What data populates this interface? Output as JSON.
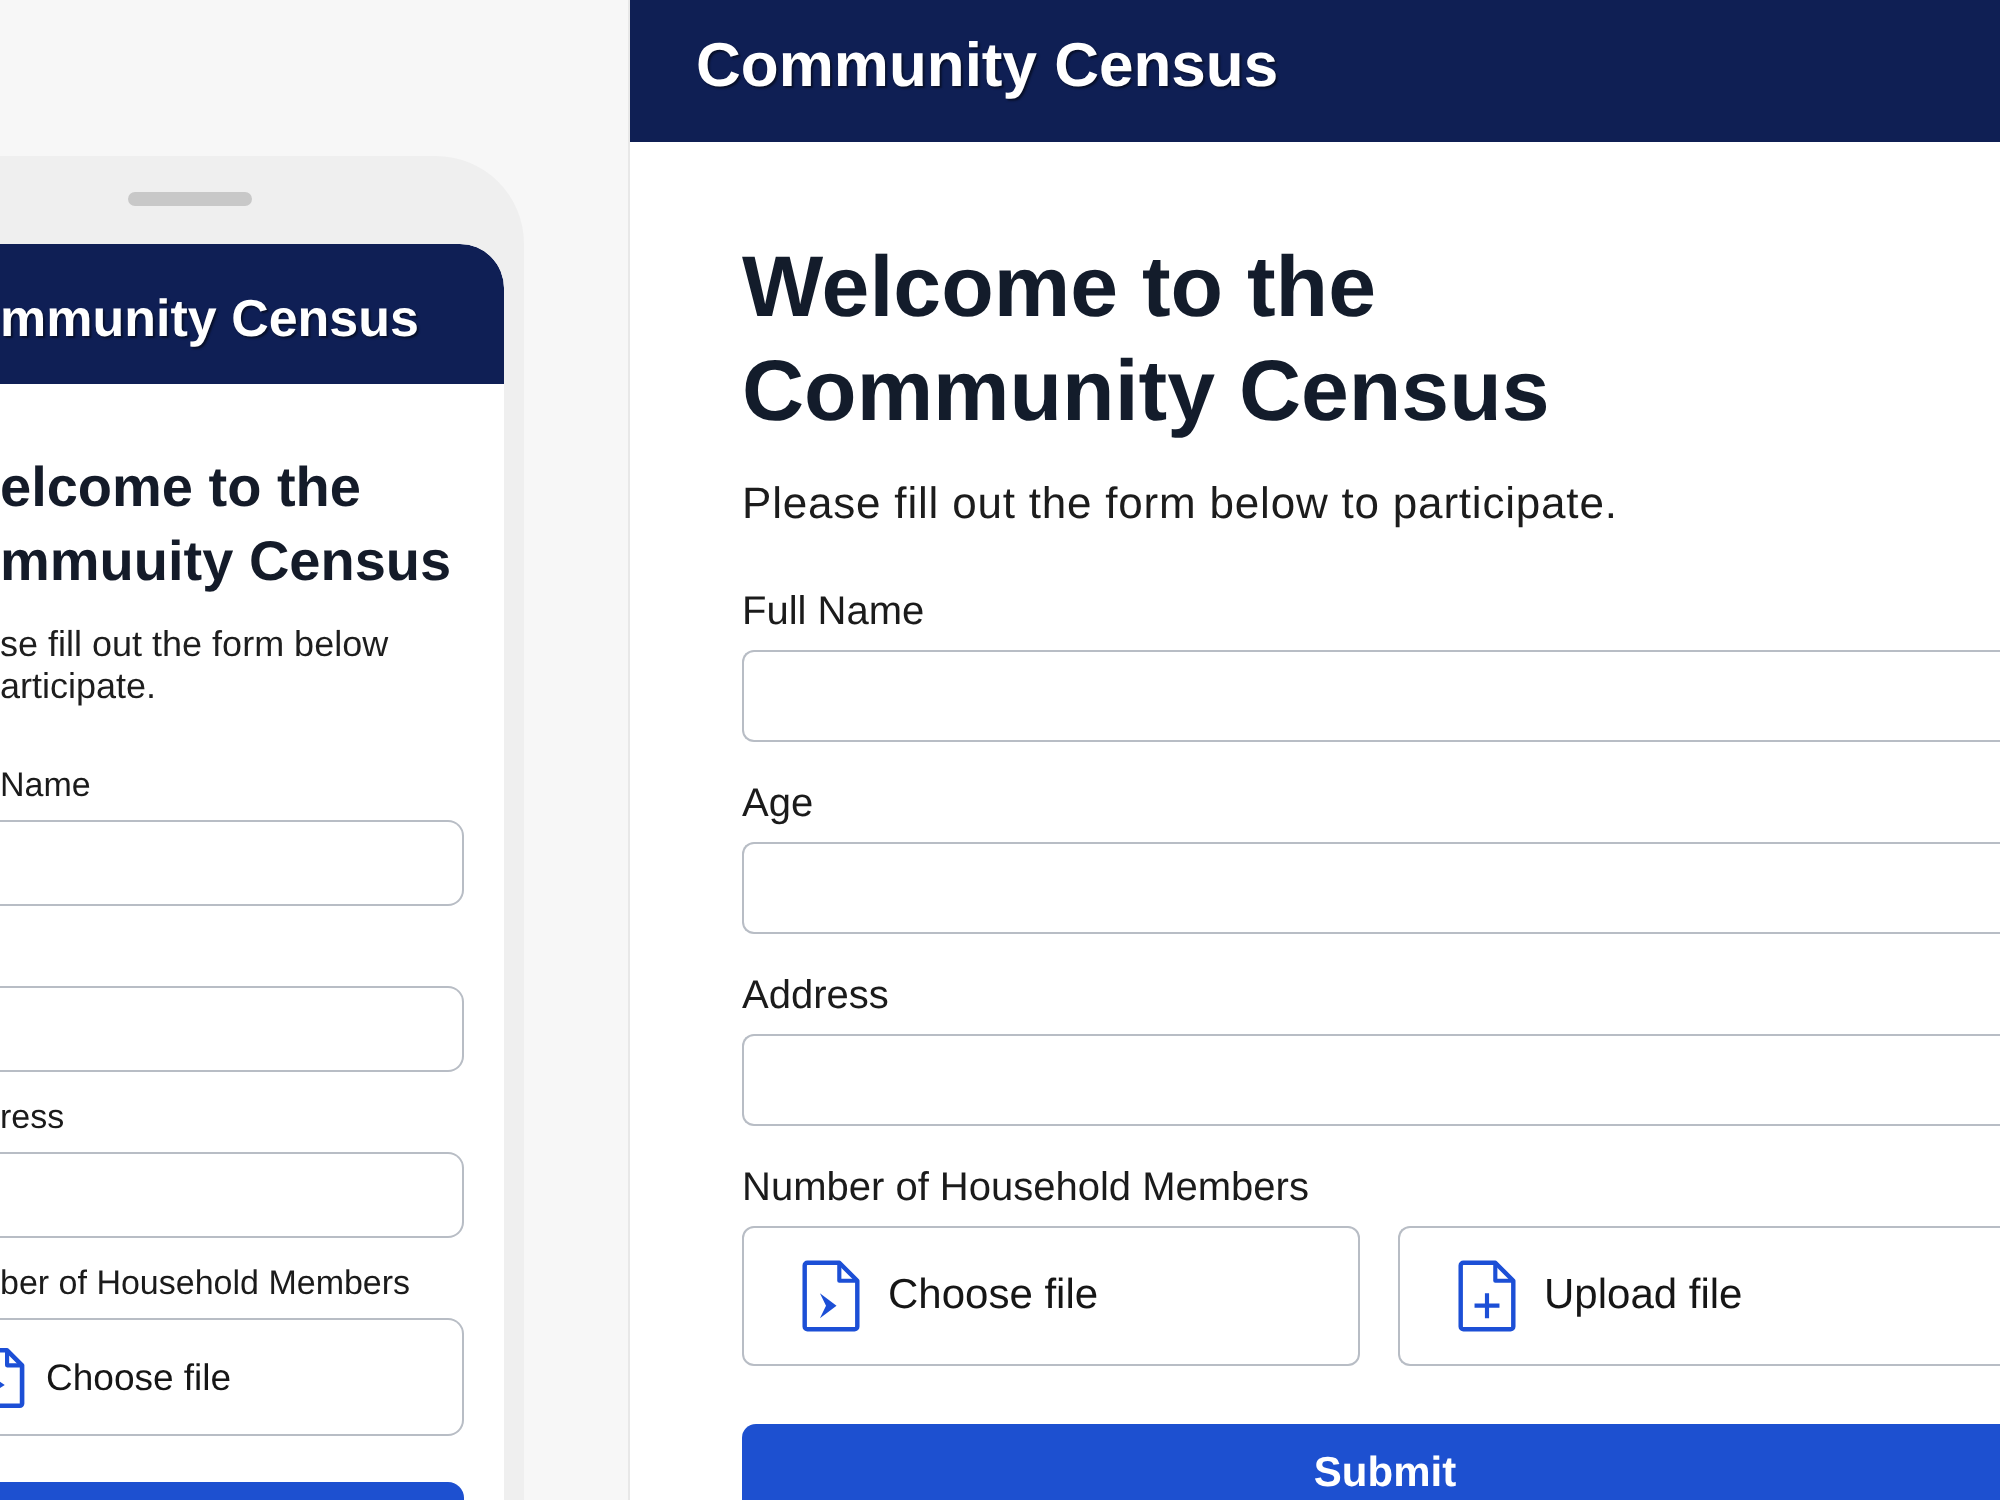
{
  "phone": {
    "header_title": "mmunity Census",
    "heading_lines": [
      "elcome to the",
      "mmuuity Census"
    ],
    "intro_lines": [
      "se fill out the form below",
      "articipate."
    ],
    "fields": [
      {
        "kind": "text",
        "label": "Name"
      },
      {
        "kind": "text"
      },
      {
        "kind": "text",
        "label": "ress"
      },
      {
        "kind": "file",
        "label": "ber of Household Members",
        "buttons": [
          {
            "kind": "choose",
            "label": "Choose file"
          }
        ]
      }
    ]
  },
  "header": {
    "title": "Community Census"
  },
  "form": {
    "heading": "Welcome to the Community Census",
    "intro": "Please fill out the form below to participate.",
    "fields": [
      {
        "kind": "text",
        "label": "Full Name"
      },
      {
        "kind": "text",
        "label": "Age"
      },
      {
        "kind": "text",
        "label": "Address"
      },
      {
        "kind": "file",
        "label": "Number of Household Members",
        "buttons": [
          {
            "kind": "choose",
            "label": "Choose file"
          },
          {
            "kind": "upload",
            "label": "Upload file"
          }
        ]
      }
    ],
    "submit": "Submit"
  }
}
